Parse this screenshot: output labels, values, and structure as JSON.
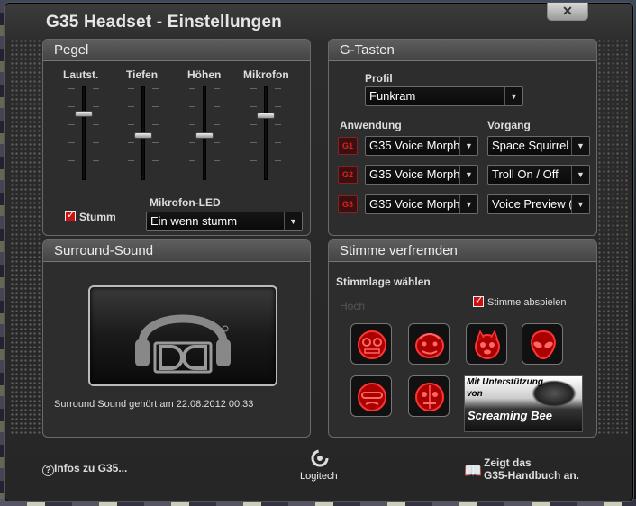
{
  "window": {
    "title": "G35 Headset - Einstellungen",
    "close_label": "✕"
  },
  "pegel": {
    "header": "Pegel",
    "sliders": [
      {
        "label": "Lautst.",
        "level": 0.28
      },
      {
        "label": "Tiefen",
        "level": 0.53
      },
      {
        "label": "Höhen",
        "level": 0.53
      },
      {
        "label": "Mikrofon",
        "level": 0.3
      }
    ],
    "mute_label": "Stumm",
    "mute_checked": true,
    "mic_led_label": "Mikrofon-LED",
    "mic_led_value": "Ein wenn stumm"
  },
  "gtasten": {
    "header": "G-Tasten",
    "profile_label": "Profil",
    "profile_value": "Funkram",
    "col_app": "Anwendung",
    "col_action": "Vorgang",
    "rows": [
      {
        "key": "G1",
        "app": "G35 Voice Morph",
        "action": "Space Squirrel"
      },
      {
        "key": "G2",
        "app": "G35 Voice Morph",
        "action": "Troll On / Off"
      },
      {
        "key": "G3",
        "app": "G35 Voice Morph",
        "action": "Voice Preview ("
      }
    ]
  },
  "surround": {
    "header": "Surround-Sound",
    "status": "Surround Sound gehört am  22.08.2012 00:33"
  },
  "stimme": {
    "header": "Stimme verfremden",
    "pick_label": "Stimmlage wählen",
    "pitch_hint": "Hoch",
    "play_label": "Stimme abspielen",
    "play_checked": true,
    "sponsor_line1": "Mit Unterstützung",
    "sponsor_line2": "von",
    "sponsor_brand": "Screaming Bee"
  },
  "footer": {
    "info_label": "Infos zu G35...",
    "brand": "Logitech",
    "manual_line1": "Zeigt das",
    "manual_line2": "G35-Handbuch an."
  },
  "colors": {
    "accent_red": "#cc1111",
    "panel_bg": "#2d2d2d"
  }
}
